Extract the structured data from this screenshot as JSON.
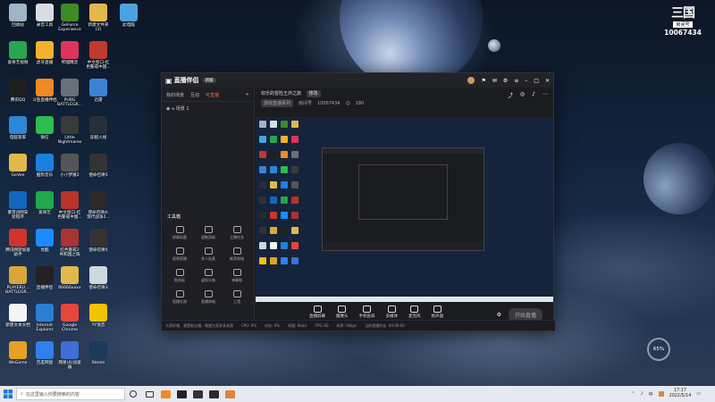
{
  "desktop_icons": [
    {
      "label": "回收站",
      "icon": "recycle-bin-icon",
      "color": "#9fb4c8"
    },
    {
      "label": "录音工具",
      "icon": "recorder-icon",
      "color": "#d8dde3"
    },
    {
      "label": "GeForce\nExperience",
      "icon": "nvidia-icon",
      "color": "#3d8b25"
    },
    {
      "label": "新建文件夹\n(3)",
      "icon": "folder-icon",
      "color": "#e2b84c"
    },
    {
      "label": "此电脑",
      "icon": "computer-icon",
      "color": "#4aa3e0"
    },
    {
      "label": "爱奇艺视频",
      "icon": "iqiyi-icon",
      "color": "#2aa44f"
    },
    {
      "label": "虎牙直播",
      "icon": "huya-icon",
      "color": "#f2b12e"
    },
    {
      "label": "哔哩精灵",
      "icon": "app-icon",
      "color": "#e0335a"
    },
    {
      "label": "中文窗口-红\n色警戒中国...",
      "icon": "game-icon",
      "color": "#c03a2b"
    },
    {
      "label": "腾讯QQ",
      "icon": "qq-icon",
      "color": "#1f1f1f"
    },
    {
      "label": "斗鱼直播伴侣",
      "icon": "douyu-icon",
      "color": "#f08a24"
    },
    {
      "label": "PUBG\nBATTLEGR...",
      "icon": "pubg-icon",
      "color": "#6a7078"
    },
    {
      "label": "迅雷",
      "icon": "thunder-icon",
      "color": "#3b82d6"
    },
    {
      "label": "电脑管家",
      "icon": "pc-manager-icon",
      "color": "#2d86d8"
    },
    {
      "label": "微信",
      "icon": "wechat-icon",
      "color": "#2dbd4e"
    },
    {
      "label": "Little\nNightmares",
      "icon": "game-icon",
      "color": "#3a3a3a"
    },
    {
      "label": "穿越火线",
      "icon": "game-icon",
      "color": "#27303a"
    },
    {
      "label": "GeVee",
      "icon": "folder-icon",
      "color": "#e2b84c"
    },
    {
      "label": "酷狗音乐",
      "icon": "kugou-icon",
      "color": "#1f7fe0"
    },
    {
      "label": "小小梦魇2",
      "icon": "game-icon",
      "color": "#555"
    },
    {
      "label": "使命召唤5",
      "icon": "game-icon",
      "color": "#333"
    },
    {
      "label": "暴雪战网安\n装程序",
      "icon": "battlenet-icon",
      "color": "#1565c0"
    },
    {
      "label": "爱奇艺",
      "icon": "iqiyi-icon",
      "color": "#21a84a"
    },
    {
      "label": "中文窗口-红\n色警戒中国...",
      "icon": "game-icon",
      "color": "#b8342a"
    },
    {
      "label": "使命召唤4:\n现代战争2...",
      "icon": "game-icon",
      "color": "#2a2a2a"
    },
    {
      "label": "腾讯网游加速\n助手",
      "icon": "accelerator-icon",
      "color": "#d0352c"
    },
    {
      "label": "优酷",
      "icon": "youku-icon",
      "color": "#1a8cff"
    },
    {
      "label": "红色警戒2\n共和国之辉",
      "icon": "game-icon",
      "color": "#a33"
    },
    {
      "label": "使命召唤5",
      "icon": "game-icon",
      "color": "#333"
    },
    {
      "label": "PLAYERU...\nBATTLEGR...",
      "icon": "pubg-icon",
      "color": "#d8a73a"
    },
    {
      "label": "直播伴侣",
      "icon": "live-companion-icon",
      "color": "#222"
    },
    {
      "label": "66666xxxx",
      "icon": "folder-icon",
      "color": "#e2b84c"
    },
    {
      "label": "使命召唤3",
      "icon": "game-icon",
      "color": "#cfd8e0"
    },
    {
      "label": "新建文本文档",
      "icon": "text-doc-icon",
      "color": "#f4f4f4"
    },
    {
      "label": "Internet\nExplorer",
      "icon": "ie-icon",
      "color": "#2a7fd4"
    },
    {
      "label": "Google\nChrome",
      "icon": "chrome-icon",
      "color": "#e8453c"
    },
    {
      "label": "YY语音",
      "icon": "yy-icon",
      "color": "#f2c300"
    },
    {
      "label": "WeGame",
      "icon": "wegame-icon",
      "color": "#e6a024"
    },
    {
      "label": "百度网盘",
      "icon": "baidu-pan-icon",
      "color": "#2f80ed"
    },
    {
      "label": "网易UU加速\n器",
      "icon": "uu-icon",
      "color": "#3d6fd6"
    },
    {
      "label": "Steam",
      "icon": "steam-icon",
      "color": "#1b3a5c"
    }
  ],
  "badge": {
    "logo": "三国",
    "subtitle": "房间号",
    "room": "10067434"
  },
  "app": {
    "title": "直播伴侣",
    "version": "新版",
    "tabs": [
      "我的场景",
      "互动",
      "可直播"
    ],
    "scene": "场景 1",
    "tools_title": "工具箱",
    "tools": [
      "屏幕标题",
      "道聚直新",
      "主播任务",
      "视频直播",
      "多人连麦",
      "推荐商城",
      "贴纸板",
      "虚拟头像",
      "弹幕图",
      "直播礼物",
      "直播商城",
      "上墙"
    ],
    "stream_title": "欢乐的冒险王炸之旅",
    "stream_tag": "修改",
    "category": "游戏直播系列",
    "room_label": "房间号",
    "room_id": "10067434",
    "viewers": "180",
    "controls": [
      "直播屏幕",
      "摄像头",
      "手机投屏",
      "多媒体",
      "麦克风",
      "扬声器"
    ],
    "start_btn": "开始直播",
    "status": [
      "大家好哦，我是新主播，希望大家多多关照",
      "CPU: 0%",
      "内存: 0%",
      "网速: 0kb/s",
      "FPS: 60",
      "码率: 0kbps",
      "当前直播时长: 00:00:00"
    ]
  },
  "speed_widget": "65%",
  "taskbar": {
    "search_placeholder": "在这里输入你要搜索的内容",
    "time": "17:17",
    "date": "2022/5/14",
    "ime": "中"
  },
  "colors": {
    "accent": "#ff6a3d",
    "taskbar": "#e6eaf0"
  }
}
